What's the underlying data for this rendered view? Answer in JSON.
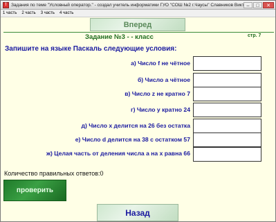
{
  "window": {
    "title": "Задания по теме \"Условный оператор.\" - создал учитель информатики ГУО \"СОШ №2 г.Чаусы\" Славников Виктор Вас...",
    "controls": {
      "minimize": "–",
      "maximize": "□",
      "close": "✕"
    }
  },
  "menu": [
    "1 часть",
    "2 часть",
    "3 часть",
    "4 часть"
  ],
  "nav": {
    "forward_label": "Вперед",
    "back_label": "Назад"
  },
  "task": {
    "title": "Задание №3 -  -  класс",
    "page": "стр. 7"
  },
  "instruction": "Запишите на языке Паскаль следующие условия:",
  "questions": [
    {
      "label": "а) Число f не чётное",
      "value": ""
    },
    {
      "label": "б) Число а чётное",
      "value": ""
    },
    {
      "label": "в) Число z не кратно 7",
      "value": ""
    },
    {
      "label": "г) Число у кратно 24",
      "value": ""
    },
    {
      "label": "д) Число х делится на 26 без остатка",
      "value": ""
    },
    {
      "label": "е) Число d делится на 38 с остатком 57",
      "value": ""
    },
    {
      "label": "ж) Целая часть от деления числа а на х равна 66",
      "value": ""
    }
  ],
  "result": {
    "label": "Количество правильных ответов:",
    "value": "0"
  },
  "check_label": "проверить"
}
